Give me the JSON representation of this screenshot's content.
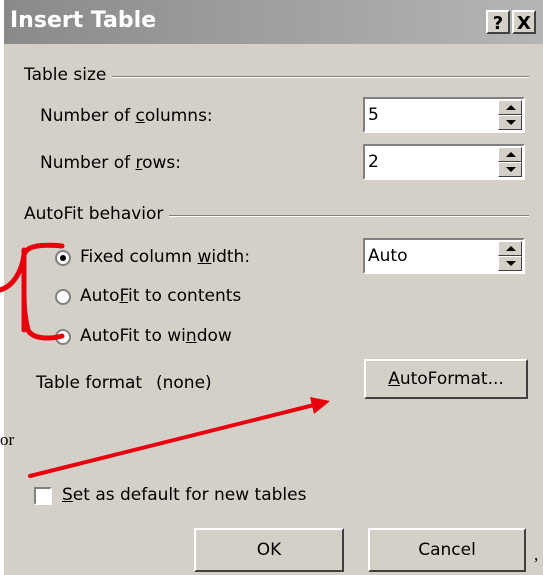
{
  "dialog": {
    "title": "Insert Table",
    "help_button": "?",
    "close_button": "X"
  },
  "table_size": {
    "group_label": "Table size",
    "columns_label": {
      "pre": "Number of ",
      "u": "c",
      "post": "olumns:"
    },
    "columns_value": "5",
    "rows_label": {
      "pre": "Number of ",
      "u": "r",
      "post": "ows:"
    },
    "rows_value": "2"
  },
  "autofit": {
    "group_label": "AutoFit behavior",
    "fixed_width": {
      "pre": "Fixed column ",
      "u": "w",
      "post": "idth:",
      "selected": true
    },
    "fixed_width_value": "Auto",
    "autofit_contents": {
      "pre": "Auto",
      "u": "F",
      "post": "it to contents",
      "selected": false
    },
    "autofit_window": {
      "pre": "AutoFit to wi",
      "u": "n",
      "post": "dow",
      "selected": false
    }
  },
  "table_format": {
    "label": "Table format",
    "value": "(none)",
    "autoformat_button": {
      "u": "A",
      "post": "utoFormat..."
    }
  },
  "default_checkbox": {
    "u": "S",
    "post": "et as default for new tables",
    "checked": false
  },
  "buttons": {
    "ok": "OK",
    "cancel": "Cancel"
  },
  "background_fragments": {
    "left_text": "or",
    "bottom_text": ","
  },
  "annotation": {
    "color": "#e8000d"
  }
}
